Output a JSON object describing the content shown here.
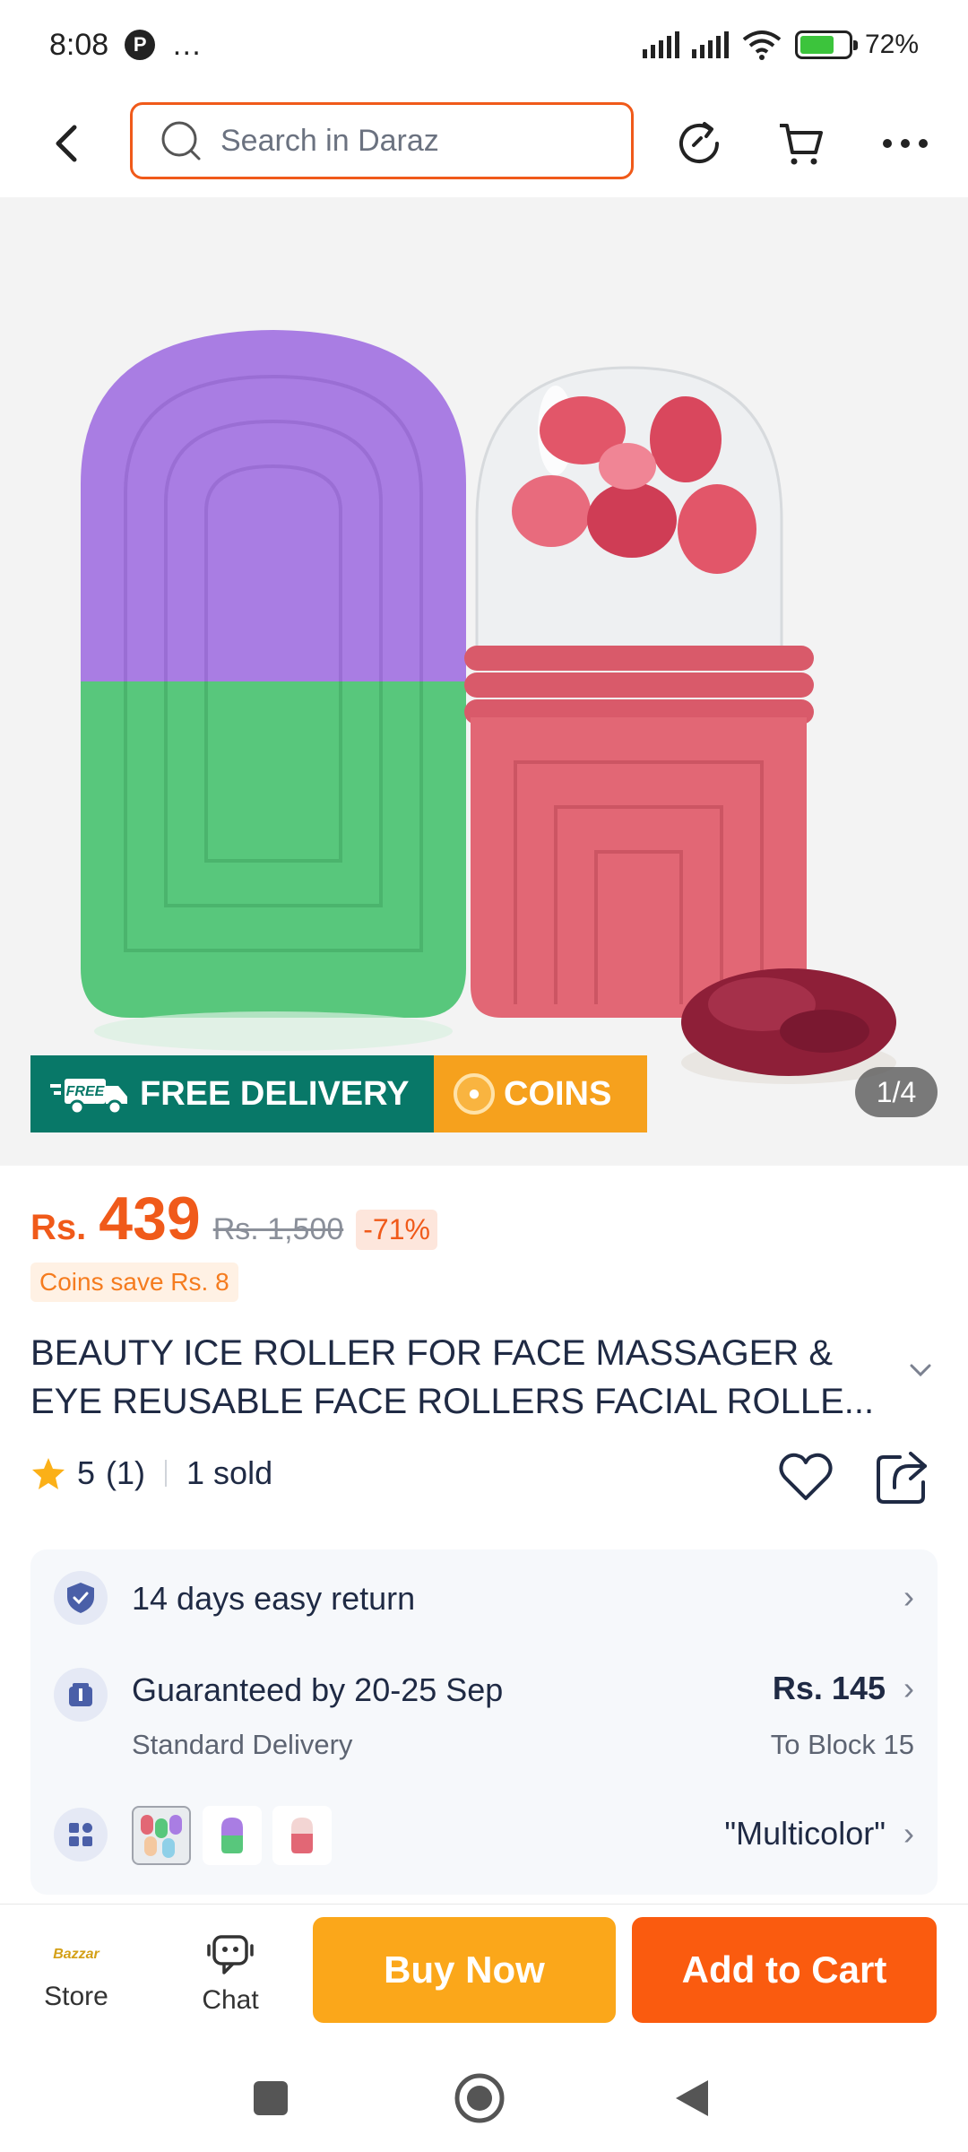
{
  "status_bar": {
    "time": "8:08",
    "more": "…",
    "battery_pct": "72%",
    "battery_level": 0.72
  },
  "header": {
    "search_placeholder": "Search in Daraz"
  },
  "gallery": {
    "badge_free": "FREE DELIVERY",
    "badge_free_icon_text": "FREE",
    "badge_coins": "COINS",
    "counter": "1/4"
  },
  "price": {
    "currency": "Rs.",
    "value": "439",
    "old": "Rs. 1,500",
    "discount": "-71%",
    "coins_save": "Coins save Rs. 8"
  },
  "product": {
    "title_line1": "BEAUTY ICE ROLLER FOR FACE MASSAGER &",
    "title_line2": "EYE REUSABLE FACE ROLLERS FACIAL ROLLE..."
  },
  "rating": {
    "score": "5",
    "count": "(1)",
    "sold": "1 sold"
  },
  "info": {
    "return_text": "14 days easy return",
    "delivery_title": "Guaranteed by 20-25 Sep",
    "delivery_sub": "Standard Delivery",
    "delivery_price": "Rs. 145",
    "delivery_to": "To Block 15",
    "variant_label": "\"Multicolor\""
  },
  "bottom": {
    "store_logo": "Bazzar",
    "store_label": "Store",
    "chat_label": "Chat",
    "buy_now": "Buy Now",
    "add_to_cart": "Add to Cart"
  },
  "colors": {
    "accent": "#f05a1a",
    "buy": "#fba71a",
    "cart": "#fa5b0f",
    "free_badge": "#087868",
    "coins_badge": "#f6a11d"
  }
}
